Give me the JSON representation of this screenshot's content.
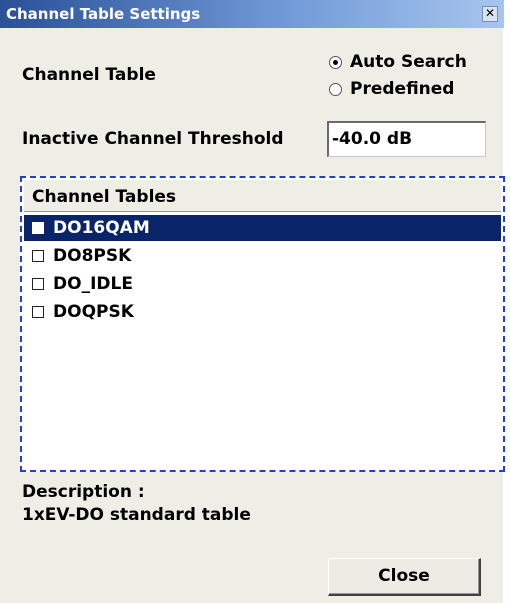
{
  "window": {
    "title": "Channel Table Settings",
    "close_glyph": "✕"
  },
  "channel_table": {
    "label": "Channel Table",
    "options": [
      {
        "label": "Auto Search",
        "checked": true
      },
      {
        "label": "Predefined",
        "checked": false
      }
    ]
  },
  "threshold": {
    "label": "Inactive Channel Threshold",
    "value": "-40.0 dB"
  },
  "tables": {
    "header": "Channel Tables",
    "items": [
      {
        "label": "DO16QAM",
        "selected": true,
        "checked": false
      },
      {
        "label": "DO8PSK",
        "selected": false,
        "checked": false
      },
      {
        "label": "DO_IDLE",
        "selected": false,
        "checked": false
      },
      {
        "label": "DOQPSK",
        "selected": false,
        "checked": false
      }
    ]
  },
  "description": {
    "label": "Description :",
    "text": "1xEV-DO standard table"
  },
  "buttons": {
    "close_label": "Close"
  },
  "colors": {
    "selection": "#0a246a",
    "focus_border": "#1f3fd8",
    "title_bar": "#2a5098"
  }
}
